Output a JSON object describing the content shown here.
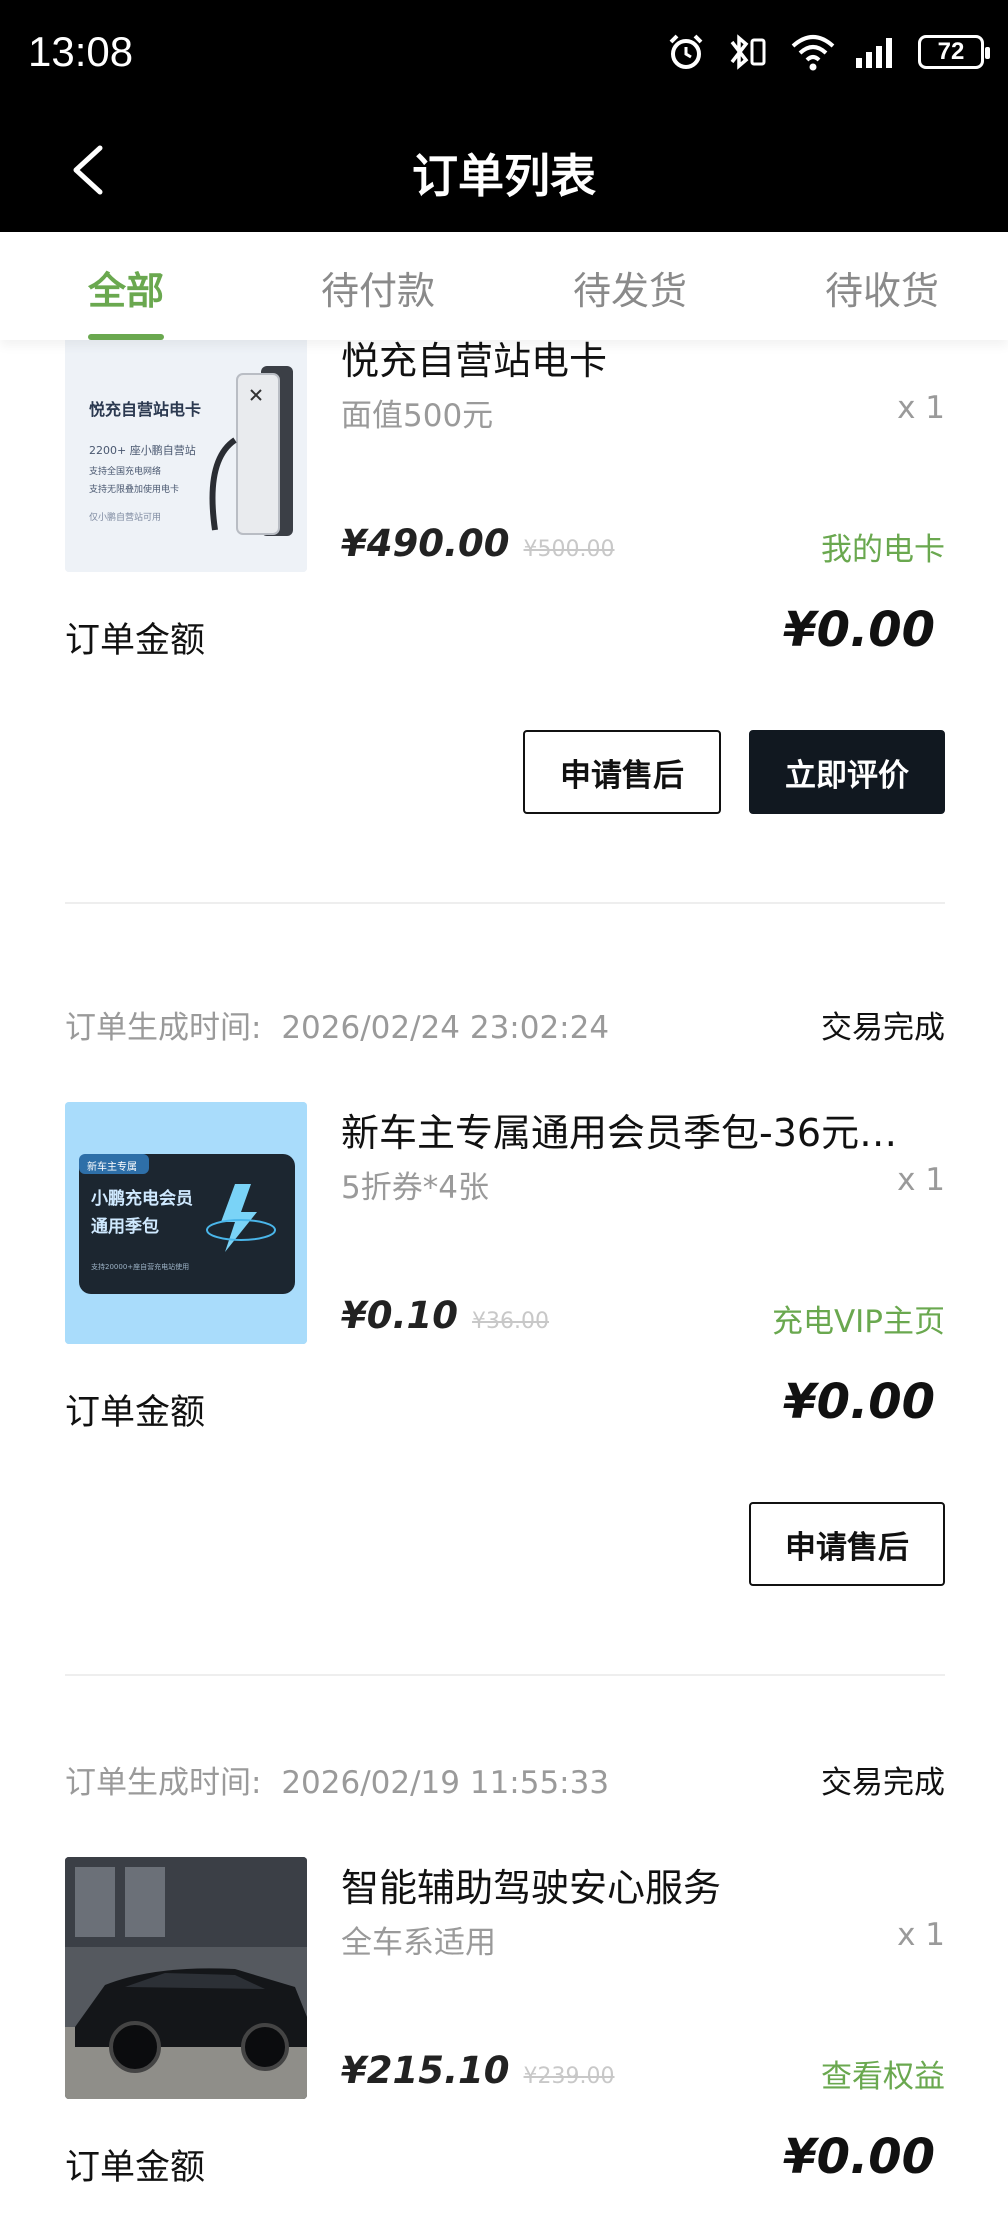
{
  "status_bar": {
    "time": "13:08",
    "battery": "72"
  },
  "nav": {
    "title": "订单列表"
  },
  "tabs": [
    {
      "label": "全部",
      "active": true
    },
    {
      "label": "待付款",
      "active": false
    },
    {
      "label": "待发货",
      "active": false
    },
    {
      "label": "待收货",
      "active": false
    }
  ],
  "orders": [
    {
      "product": {
        "title": "悦充自营站电卡",
        "spec": "面值500元",
        "qty": "x 1",
        "price": "¥490.00",
        "orig_price": "¥500.00",
        "link": "我的电卡",
        "thumb_texts": [
          "悦充自营站电卡",
          "2200+ 座小鹏自营站",
          "支持全国充电网络",
          "支持无限叠加使用电卡",
          "仅小鹏自营站可用"
        ]
      },
      "amount_label": "订单金额",
      "amount": "¥0.00",
      "buttons": [
        "申请售后",
        "立即评价"
      ]
    },
    {
      "time_label": "订单生成时间:",
      "time": "2026/02/24 23:02:24",
      "status": "交易完成",
      "product": {
        "title": "新车主专属通用会员季包-36元…",
        "spec": "5折券*4张",
        "qty": "x 1",
        "price": "¥0.10",
        "orig_price": "¥36.00",
        "link": "充电VIP主页",
        "thumb_texts": [
          "新车主专属",
          "小鹏充电会员",
          "通用季包",
          "支持20000+座自营充电站使用"
        ]
      },
      "amount_label": "订单金额",
      "amount": "¥0.00",
      "buttons": [
        "申请售后"
      ]
    },
    {
      "time_label": "订单生成时间:",
      "time": "2026/02/19 11:55:33",
      "status": "交易完成",
      "product": {
        "title": "智能辅助驾驶安心服务",
        "spec": "全车系适用",
        "qty": "x 1",
        "price": "¥215.10",
        "orig_price": "¥239.00",
        "link": "查看权益"
      },
      "amount_label": "订单金额",
      "amount": "¥0.00"
    }
  ],
  "colors": {
    "accent": "#6aa84f",
    "dark_button": "#111820",
    "header_bg": "#000000"
  }
}
